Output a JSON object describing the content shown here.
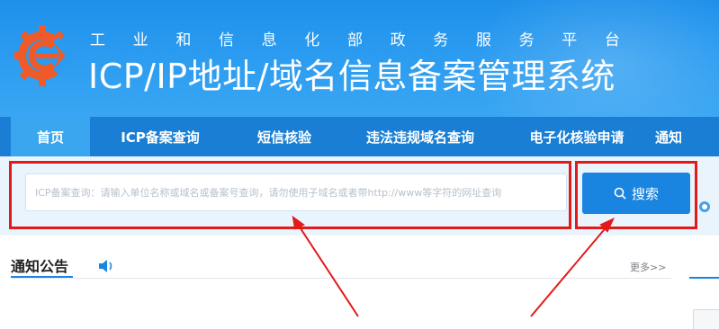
{
  "header": {
    "subtitle_chars": [
      "工",
      "业",
      "和",
      "信",
      "息",
      "化",
      "部",
      "政",
      "务",
      "服",
      "务",
      "平",
      "台"
    ],
    "title": "ICP/IP地址/域名信息备案管理系统"
  },
  "nav": {
    "items": [
      {
        "label": "首页",
        "active": true
      },
      {
        "label": "ICP备案查询",
        "active": false
      },
      {
        "label": "短信核验",
        "active": false
      },
      {
        "label": "违法违规域名查询",
        "active": false
      },
      {
        "label": "电子化核验申请",
        "active": false
      },
      {
        "label": "通知",
        "active": false
      }
    ]
  },
  "search": {
    "placeholder": "ICP备案查询：请输入单位名称或域名或备案号查询，请勿使用子域名或者带http://www等字符的网址查询",
    "button_label": "搜索",
    "search_icon": "search-icon"
  },
  "notice": {
    "title": "通知公告",
    "icon": "speaker-icon",
    "more_label": "更多>>"
  },
  "colors": {
    "header_blue": "#2a9bf0",
    "nav_blue": "#1a7fd4",
    "nav_active": "#3aa6f0",
    "button_blue": "#1a85e0",
    "annotation_red": "#e21a1a"
  }
}
